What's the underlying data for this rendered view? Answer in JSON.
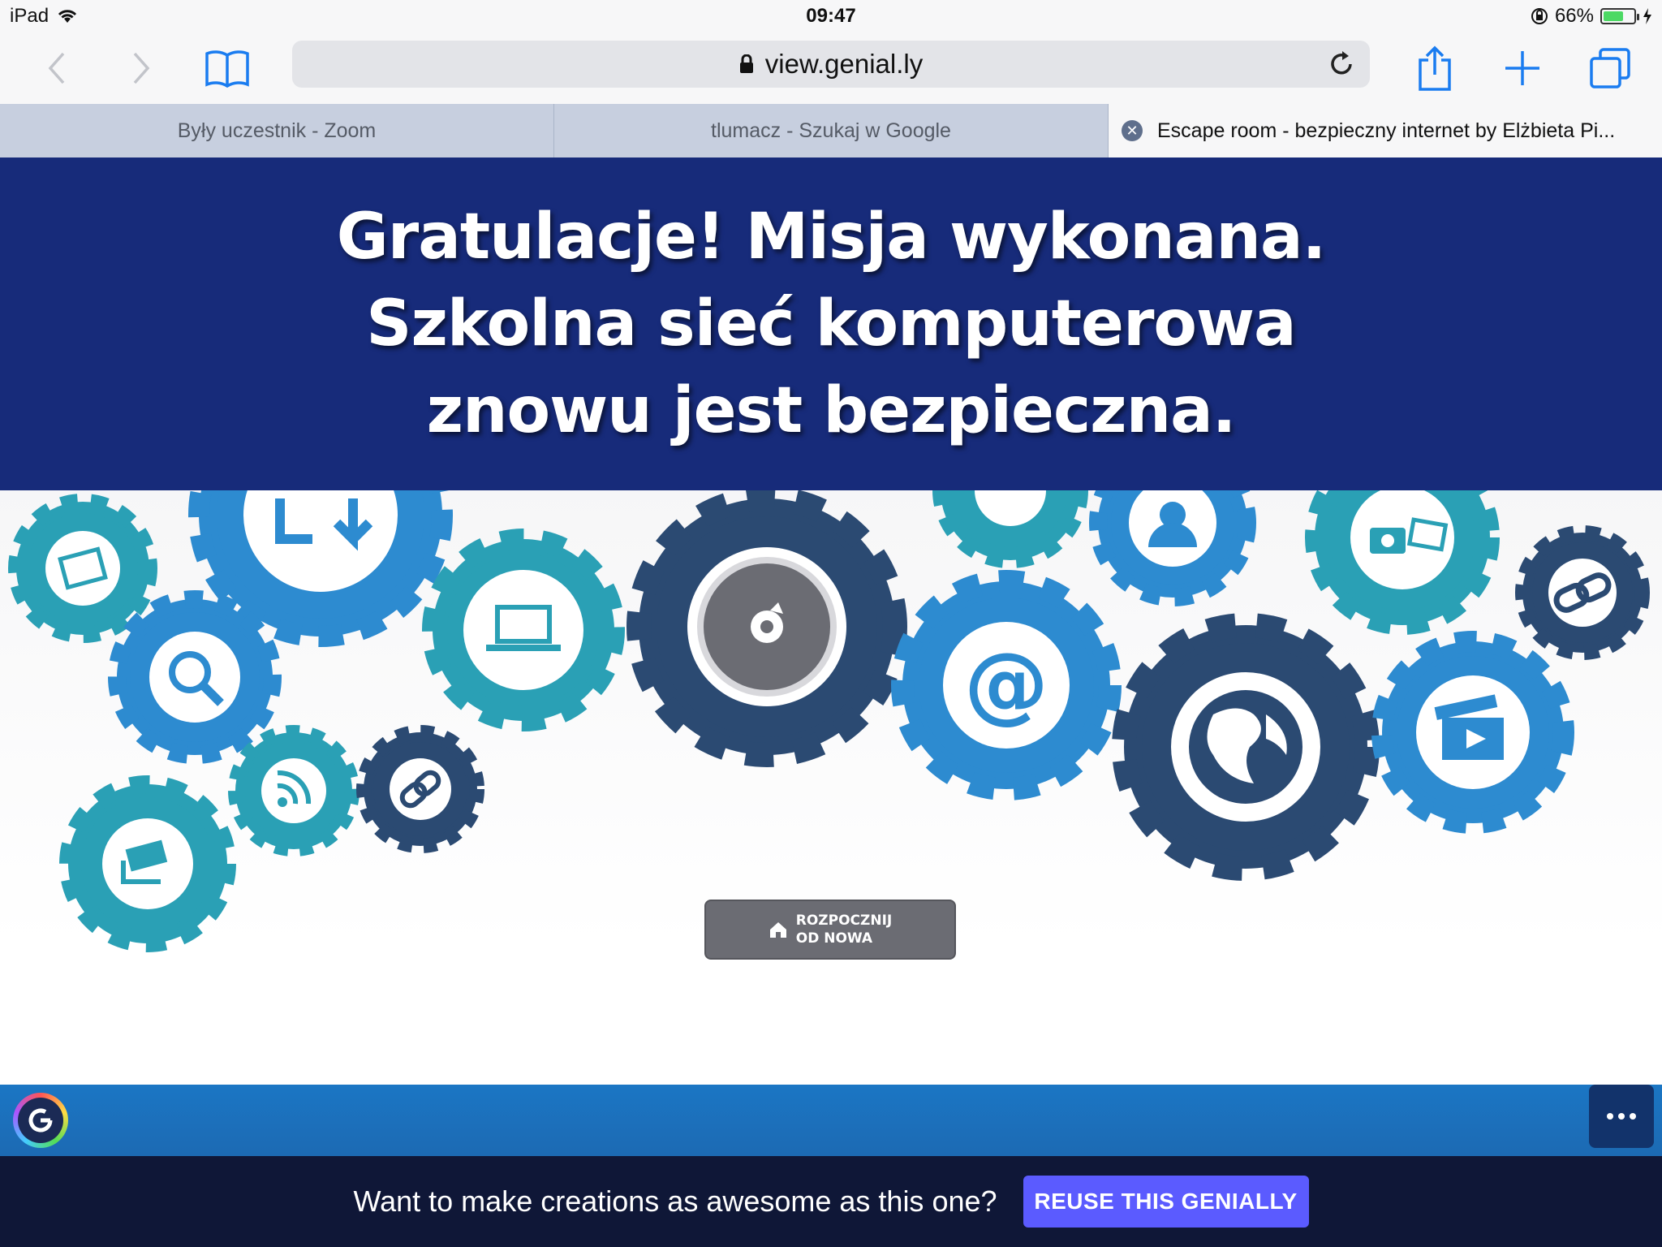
{
  "status_bar": {
    "device": "iPad",
    "time": "09:47",
    "battery": "66%",
    "battery_level": 0.66
  },
  "toolbar": {
    "url": "view.genial.ly",
    "icons": [
      "back-icon",
      "forward-icon",
      "bookmarks-icon",
      "lock-icon",
      "reload-icon",
      "share-icon",
      "new-tab-icon",
      "tabs-icon"
    ]
  },
  "tabs": [
    {
      "label": "Były uczestnik - Zoom"
    },
    {
      "label": "tlumacz - Szukaj w Google"
    },
    {
      "label": "Escape room - bezpieczny internet by Elżbieta Pi..."
    }
  ],
  "page": {
    "heading_line1": "Gratulacje! Misja wykonana.",
    "heading_line2": "Szkolna sieć komputerowa",
    "heading_line3": "znowu jest bezpieczna.",
    "restart_line1": "ROZPOCZNIJ",
    "restart_line2": "OD NOWA",
    "gear_icons": [
      "file-icon",
      "download-icon",
      "search-icon",
      "rss-icon",
      "link-icon",
      "money-icon",
      "laptop-icon",
      "target-icon",
      "at-icon",
      "user-icon",
      "globe-icon",
      "camera-icon",
      "video-icon"
    ]
  },
  "colors": {
    "banner": "#172b7a",
    "teal": "#2aa0b5",
    "blue": "#2d8bd0",
    "navy": "#2b4a72",
    "reuse_button": "#5b5bff",
    "promo_bar": "#0f1737"
  },
  "footer": {
    "promo_text": "Want to make creations as awesome as this one?",
    "reuse_label": "REUSE THIS GENIALLY"
  }
}
